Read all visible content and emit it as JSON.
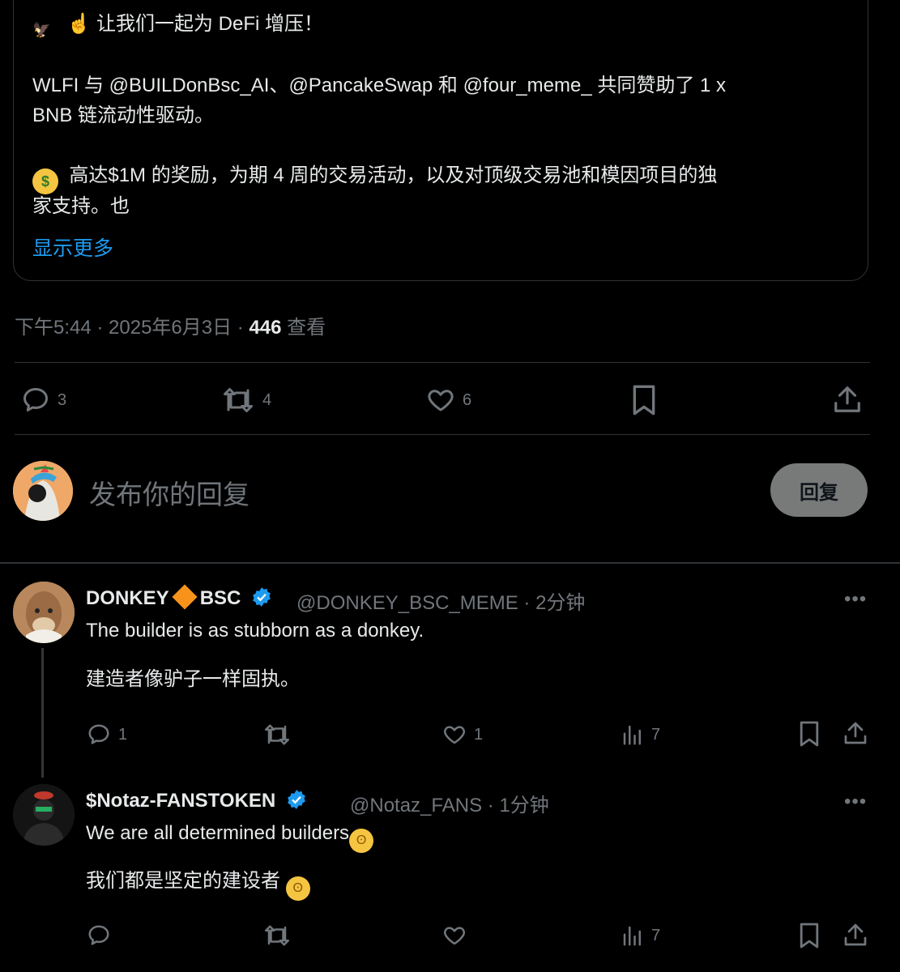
{
  "quoted_tweet": {
    "line1": "让我们一起为 DeFi 增压！",
    "line2": "WLFI 与 @BUILDonBsc_AI、@PancakeSwap 和 @four_meme_ 共同赞助了 1 x",
    "line3": "BNB 链流动性驱动。",
    "line4": "高达$1M 的奖励，为期 4 周的交易活动，以及对顶级交易池和模因项目的独",
    "line5": "家支持。也",
    "show_more": "显示更多"
  },
  "meta": {
    "time": "下午5:44 · 2025年6月3日 · ",
    "views": "446",
    "views_label": " 查看"
  },
  "main_actions": {
    "replies": "3",
    "retweets": "4",
    "likes": "6"
  },
  "reply_composer": {
    "placeholder": "发布你的回复",
    "button": "回复"
  },
  "replies": [
    {
      "name_part1": "DONKEY",
      "name_part2": "BSC",
      "handle": "@DONKEY_BSC_MEME · 2分钟",
      "text1": "The builder is as stubborn as a donkey.",
      "text2": "建造者像驴子一样固执。",
      "replies": "1",
      "retweets": "",
      "likes": "1",
      "views": "7"
    },
    {
      "name": "$Notaz-FANSTOKEN",
      "handle": "@Notaz_FANS · 1分钟",
      "text1": "We are all determined builders",
      "text2": "我们都是坚定的建设者 ",
      "replies": "",
      "retweets": "",
      "likes": "",
      "views": "7"
    }
  ],
  "more_label": "•••",
  "colors": {
    "accent": "#1d9bf0",
    "muted": "#71767b",
    "background": "#000000"
  }
}
